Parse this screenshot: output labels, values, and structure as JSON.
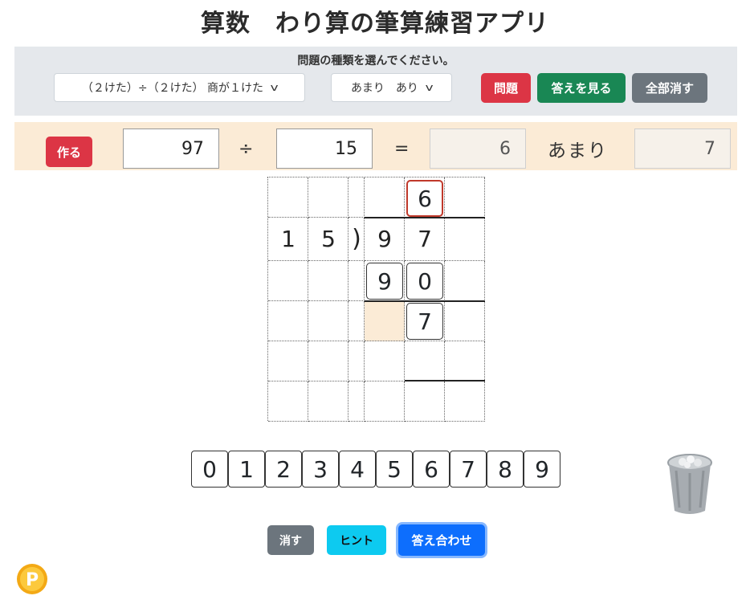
{
  "app": {
    "title": "算数　わり算の筆算練習アプリ"
  },
  "controls": {
    "label": "問題の種類を選んでください。",
    "problem_type": "（２けた）÷（２けた） 商が１けた",
    "remainder_option": "あまり　あり",
    "problem_button": "問題",
    "show_answer_button": "答えを見る",
    "clear_all_button": "全部消す"
  },
  "equation": {
    "make_button": "作る",
    "dividend": "97",
    "divide_symbol": "÷",
    "divisor": "15",
    "equals_symbol": "=",
    "quotient": "6",
    "remainder_label": "あまり",
    "remainder": "7"
  },
  "workspace": {
    "quotient_digit": "6",
    "divisor_digits": [
      "1",
      "5"
    ],
    "bracket": ")",
    "dividend_digits": [
      "9",
      "7"
    ],
    "product_digits": [
      "9",
      "0"
    ],
    "remainder_digit": "7"
  },
  "keypad": {
    "keys": [
      "0",
      "1",
      "2",
      "3",
      "4",
      "5",
      "6",
      "7",
      "8",
      "9"
    ]
  },
  "actions": {
    "erase_button": "消す",
    "hint_button": "ヒント",
    "check_button": "答え合わせ"
  },
  "icons": {
    "trash": "trash-can-icon",
    "points": "point-coin-icon"
  },
  "colors": {
    "red": "#dc3545",
    "green": "#198754",
    "gray": "#6c757d",
    "cyan": "#0dcaf0",
    "blue": "#0d6efd",
    "equation_bg": "#fbebd6",
    "panel_bg": "#e5e8ec",
    "highlight_cell": "#fbebd6"
  }
}
